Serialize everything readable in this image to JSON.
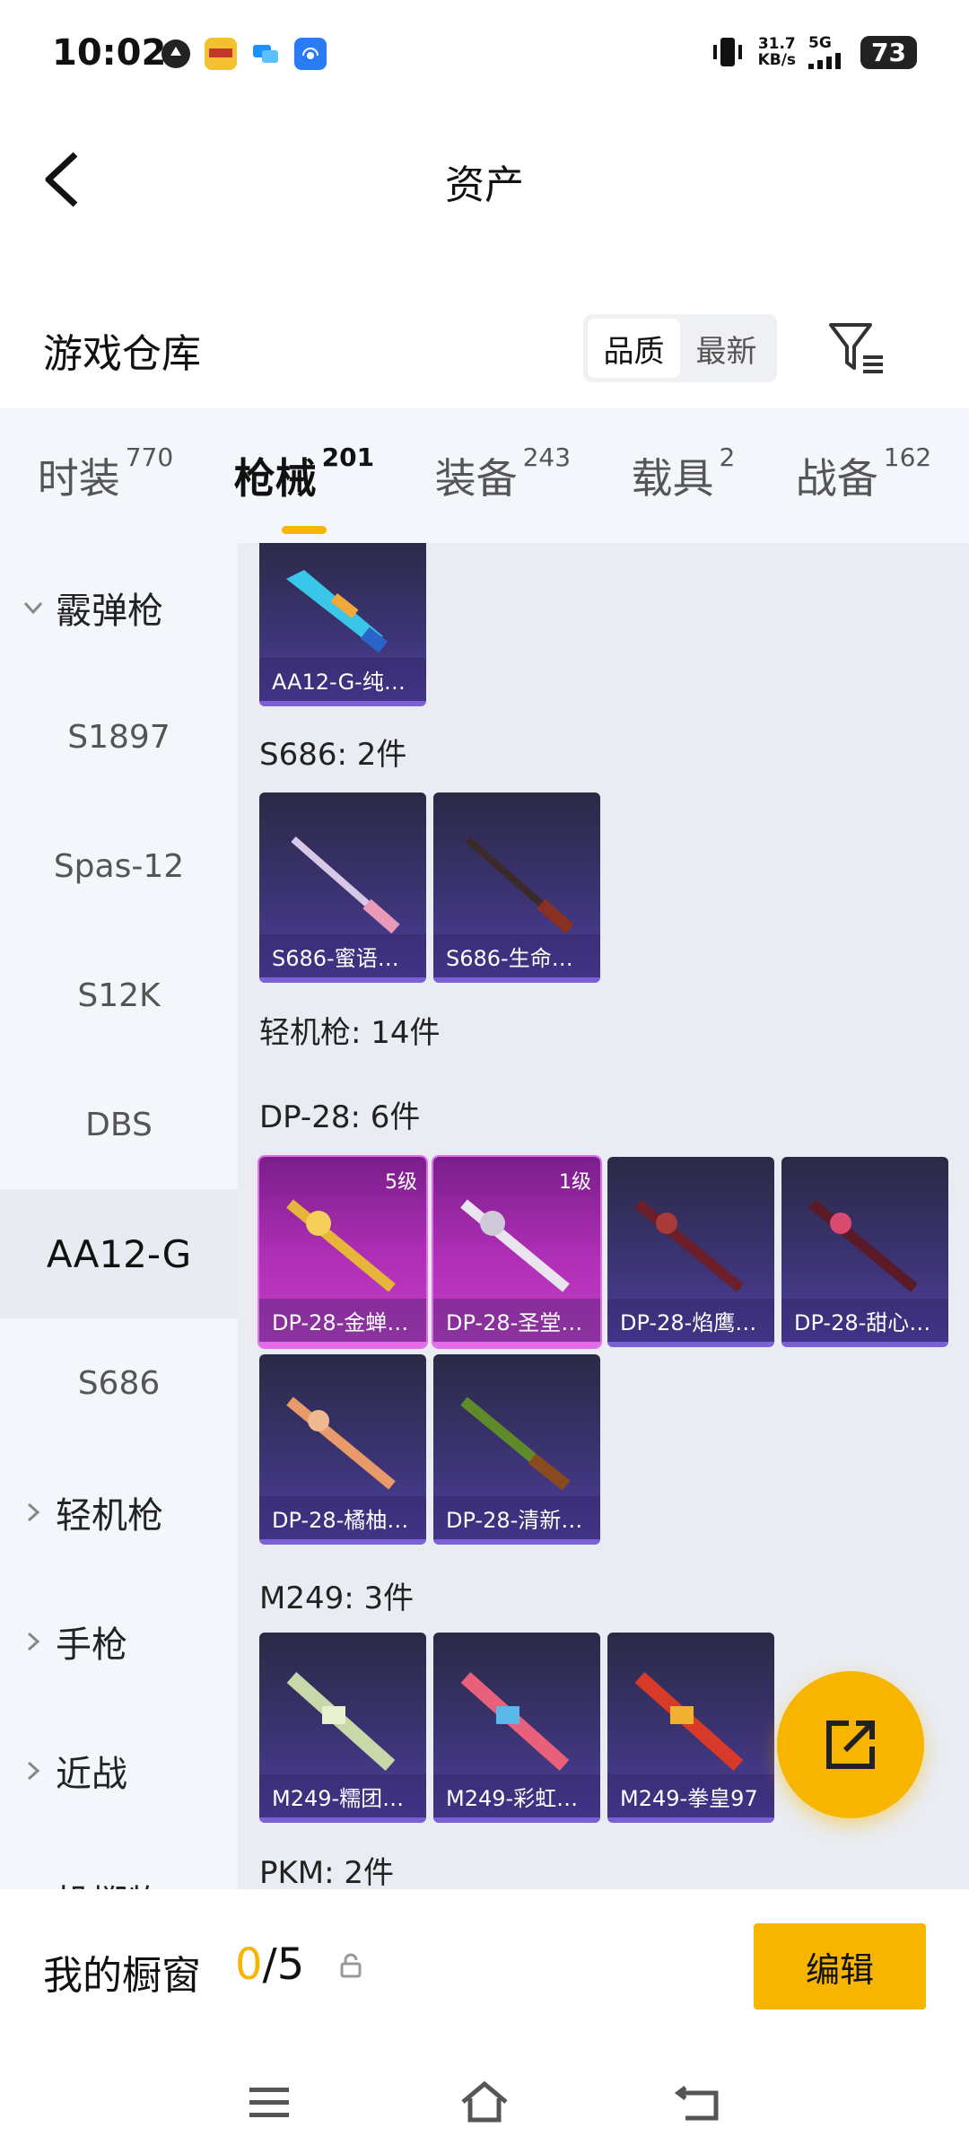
{
  "status_bar": {
    "time": "10:02",
    "net_speed_value": "31.7",
    "net_speed_unit": "KB/s",
    "network": "5G",
    "battery": "73"
  },
  "header": {
    "title": "资产"
  },
  "warehouse": {
    "title": "游戏仓库",
    "sort_options": [
      "品质",
      "最新"
    ],
    "active_sort": "品质"
  },
  "tabs": [
    {
      "label": "时装",
      "count": "770"
    },
    {
      "label": "枪械",
      "count": "201"
    },
    {
      "label": "装备",
      "count": "243"
    },
    {
      "label": "载具",
      "count": "2"
    },
    {
      "label": "战备",
      "count": "162"
    }
  ],
  "active_tab": "枪械",
  "sidebar": {
    "items": [
      {
        "label": "霰弹枪",
        "type": "group",
        "expanded": true
      },
      {
        "label": "S1897",
        "type": "item"
      },
      {
        "label": "Spas-12",
        "type": "item"
      },
      {
        "label": "S12K",
        "type": "item"
      },
      {
        "label": "DBS",
        "type": "item"
      },
      {
        "label": "AA12-G",
        "type": "item",
        "active": true
      },
      {
        "label": "S686",
        "type": "item"
      },
      {
        "label": "轻机枪",
        "type": "group",
        "expanded": false
      },
      {
        "label": "手枪",
        "type": "group",
        "expanded": false
      },
      {
        "label": "近战",
        "type": "group",
        "expanded": false
      },
      {
        "label": "投掷物",
        "type": "group",
        "expanded": false
      }
    ]
  },
  "content": {
    "top_card": {
      "name": "AA12-G-纯…"
    },
    "section_s686": "S686: 2件",
    "s686_cards": [
      {
        "name": "S686-蜜语…"
      },
      {
        "name": "S686-生命…"
      }
    ],
    "section_lmg": "轻机枪: 14件",
    "section_dp28": "DP-28: 6件",
    "dp28_cards": [
      {
        "name": "DP-28-金蝉…",
        "level": "5级",
        "rarity": "legendary"
      },
      {
        "name": "DP-28-圣堂…",
        "level": "1级",
        "rarity": "legendary"
      },
      {
        "name": "DP-28-焰鹰…",
        "level": "",
        "rarity": "epic"
      },
      {
        "name": "DP-28-甜心…",
        "level": "",
        "rarity": "epic"
      },
      {
        "name": "DP-28-橘柚…",
        "level": "",
        "rarity": "epic"
      },
      {
        "name": "DP-28-清新…",
        "level": "",
        "rarity": "epic"
      }
    ],
    "section_m249": "M249: 3件",
    "m249_cards": [
      {
        "name": "M249-糯团…"
      },
      {
        "name": "M249-彩虹…"
      },
      {
        "name": "M249-拳皇97"
      }
    ],
    "section_pkm": "PKM: 2件"
  },
  "showcase": {
    "title": "我的橱窗",
    "current": "0",
    "sep_max": "/5",
    "edit_label": "编辑"
  },
  "colors": {
    "accent": "#f7b500",
    "epic_card": "#3d3476",
    "legendary_card": "#b02fb7"
  }
}
